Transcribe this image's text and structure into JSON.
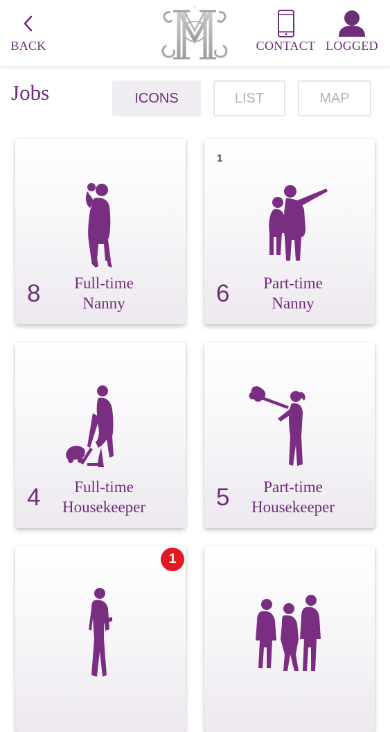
{
  "header": {
    "back_label": "BACK",
    "contact_label": "CONTACT",
    "logged_label": "LOGGED",
    "logo_letter": "M"
  },
  "page": {
    "title": "Jobs"
  },
  "tabs": [
    {
      "label": "ICONS",
      "active": true
    },
    {
      "label": "LIST",
      "active": false
    },
    {
      "label": "MAP",
      "active": false
    }
  ],
  "cards": [
    {
      "count": "8",
      "line1": "Full-time",
      "line2": "Nanny",
      "icon": "nanny-holding-child-icon"
    },
    {
      "count": "6",
      "line1": "Part-time",
      "line2": "Nanny",
      "icon": "nanny-pointing-with-child-icon",
      "small_count": "1"
    },
    {
      "count": "4",
      "line1": "Full-time",
      "line2": "Housekeeper",
      "icon": "housekeeper-vacuum-icon"
    },
    {
      "count": "5",
      "line1": "Part-time",
      "line2": "Housekeeper",
      "icon": "housekeeper-duster-icon"
    },
    {
      "icon": "businesswoman-icon",
      "badge": "1"
    },
    {
      "icon": "business-team-icon"
    }
  ],
  "colors": {
    "brand": "#6e2d78",
    "badge": "#e21b23",
    "tab_active_bg": "#efedf1",
    "tab_inactive_text": "#b3b3b3"
  }
}
